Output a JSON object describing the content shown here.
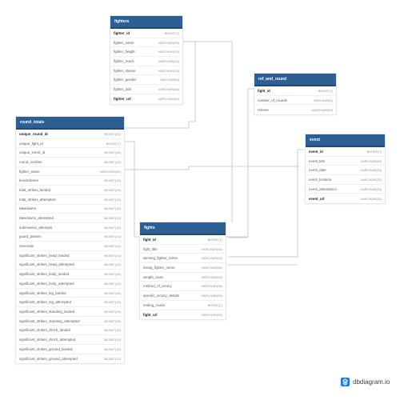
{
  "tables": [
    {
      "id": "fighters",
      "name": "fighters",
      "columns": [
        {
          "name": "fighter_id",
          "type": "BIGINT(7)",
          "key": true
        },
        {
          "name": "fighter_name",
          "type": "VARCHAR(50)"
        },
        {
          "name": "fighter_height",
          "type": "VARCHAR(10)"
        },
        {
          "name": "fighter_reach",
          "type": "VARCHAR(10)"
        },
        {
          "name": "fighter_stance",
          "type": "VARCHAR(15)"
        },
        {
          "name": "fighter_gender",
          "type": "VARCHAR(5)"
        },
        {
          "name": "fighter_dob",
          "type": "VARCHAR(50)"
        },
        {
          "name": "fighter_url",
          "type": "VARCHAR(80)",
          "key": true
        }
      ]
    },
    {
      "id": "ref_and_round",
      "name": "ref_and_round",
      "columns": [
        {
          "name": "fight_id",
          "type": "BIGINT(7)",
          "key": true
        },
        {
          "name": "number_of_rounds",
          "type": "VARCHAR(2)"
        },
        {
          "name": "referee",
          "type": "VARCHAR(40)"
        }
      ]
    },
    {
      "id": "round_totals",
      "name": "round_totals",
      "columns": [
        {
          "name": "unique_round_id",
          "type": "BIGINT(20)",
          "key": true
        },
        {
          "name": "unique_fight_id",
          "type": "BIGINT(7)"
        },
        {
          "name": "unique_event_id",
          "type": "BIGINT(10)"
        },
        {
          "name": "round_number",
          "type": "BIGINT(10)"
        },
        {
          "name": "fighter_name",
          "type": "VARCHAR(50)"
        },
        {
          "name": "knockdowns",
          "type": "BIGINT(10)"
        },
        {
          "name": "total_strikes_landed",
          "type": "BIGINT(10)"
        },
        {
          "name": "total_strikes_attempted",
          "type": "BIGINT(10)"
        },
        {
          "name": "takedowns",
          "type": "BIGINT(10)"
        },
        {
          "name": "takedowns_attempted",
          "type": "BIGINT(10)"
        },
        {
          "name": "submission_attempts",
          "type": "BIGINT(10)"
        },
        {
          "name": "guard_passes",
          "type": "BIGINT(10)"
        },
        {
          "name": "reversals",
          "type": "BIGINT(10)"
        },
        {
          "name": "significant_strikes_head_landed",
          "type": "BIGINT(10)"
        },
        {
          "name": "significant_strikes_head_attempted",
          "type": "BIGINT(10)"
        },
        {
          "name": "significant_strikes_body_landed",
          "type": "BIGINT(10)"
        },
        {
          "name": "significant_strikes_body_attempted",
          "type": "BIGINT(10)"
        },
        {
          "name": "significant_strikes_leg_landed",
          "type": "BIGINT(10)"
        },
        {
          "name": "significant_strikes_leg_attempted",
          "type": "BIGINT(10)"
        },
        {
          "name": "significant_strikes_standing_landed",
          "type": "BIGINT(10)"
        },
        {
          "name": "significant_strikes_standing_attempted",
          "type": "BIGINT(10)"
        },
        {
          "name": "significant_strikes_clinch_landed",
          "type": "BIGINT(10)"
        },
        {
          "name": "significant_strikes_clinch_attempted",
          "type": "BIGINT(10)"
        },
        {
          "name": "significant_strikes_ground_landed",
          "type": "BIGINT(10)"
        },
        {
          "name": "significant_strikes_ground_attempted",
          "type": "BIGINT(10)"
        }
      ]
    },
    {
      "id": "event",
      "name": "event",
      "columns": [
        {
          "name": "event_id",
          "type": "BIGINT(7)",
          "key": true
        },
        {
          "name": "event_title",
          "type": "VARCHAR(50)"
        },
        {
          "name": "event_date",
          "type": "VARCHAR(25)"
        },
        {
          "name": "event_location",
          "type": "VARCHAR(25)"
        },
        {
          "name": "event_attendance",
          "type": "VARCHAR(25)"
        },
        {
          "name": "event_url",
          "type": "VARCHAR(25)",
          "key": true
        }
      ]
    },
    {
      "id": "fights",
      "name": "fights",
      "columns": [
        {
          "name": "fight_id",
          "type": "BIGINT(7)",
          "key": true
        },
        {
          "name": "fight_title",
          "type": "VARCHAR(50)"
        },
        {
          "name": "winning_fighter_name",
          "type": "VARCHAR(50)"
        },
        {
          "name": "losing_fighter_name",
          "type": "VARCHAR(50)"
        },
        {
          "name": "weight_class",
          "type": "VARCHAR(50)"
        },
        {
          "name": "method_of_victory",
          "type": "VARCHAR(30)"
        },
        {
          "name": "specific_victory_details",
          "type": "VARCHAR(50)"
        },
        {
          "name": "ending_round",
          "type": "BIGINT(2)"
        },
        {
          "name": "fight_url",
          "type": "VARCHAR(80)",
          "key": true
        }
      ]
    }
  ],
  "brand": {
    "text": "dbdiagram.io"
  },
  "colors": {
    "header": "#2d5f93",
    "connector": "#b8c0c8",
    "brand": "#1f7ae0"
  }
}
